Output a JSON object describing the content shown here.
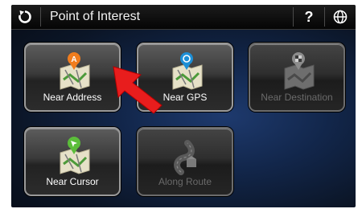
{
  "header": {
    "title": "Point of Interest"
  },
  "tiles": [
    {
      "label": "Near Address",
      "enabled": true
    },
    {
      "label": "Near GPS",
      "enabled": true
    },
    {
      "label": "Near Destination",
      "enabled": false
    },
    {
      "label": "Near Cursor",
      "enabled": true
    },
    {
      "label": "Along Route",
      "enabled": false
    }
  ],
  "colors": {
    "background": "#0b1526",
    "tile_border": "#9a9a9a",
    "pointer_arrow": "#e81d1d",
    "pin_address": "#f07d1e",
    "pin_gps": "#1d8fd6",
    "pin_cursor": "#5bbd3a",
    "pin_destination": "#8c8c8c"
  },
  "icons": {
    "back": "refresh-back-icon",
    "help": "question-mark-icon",
    "language": "globe-icon"
  }
}
